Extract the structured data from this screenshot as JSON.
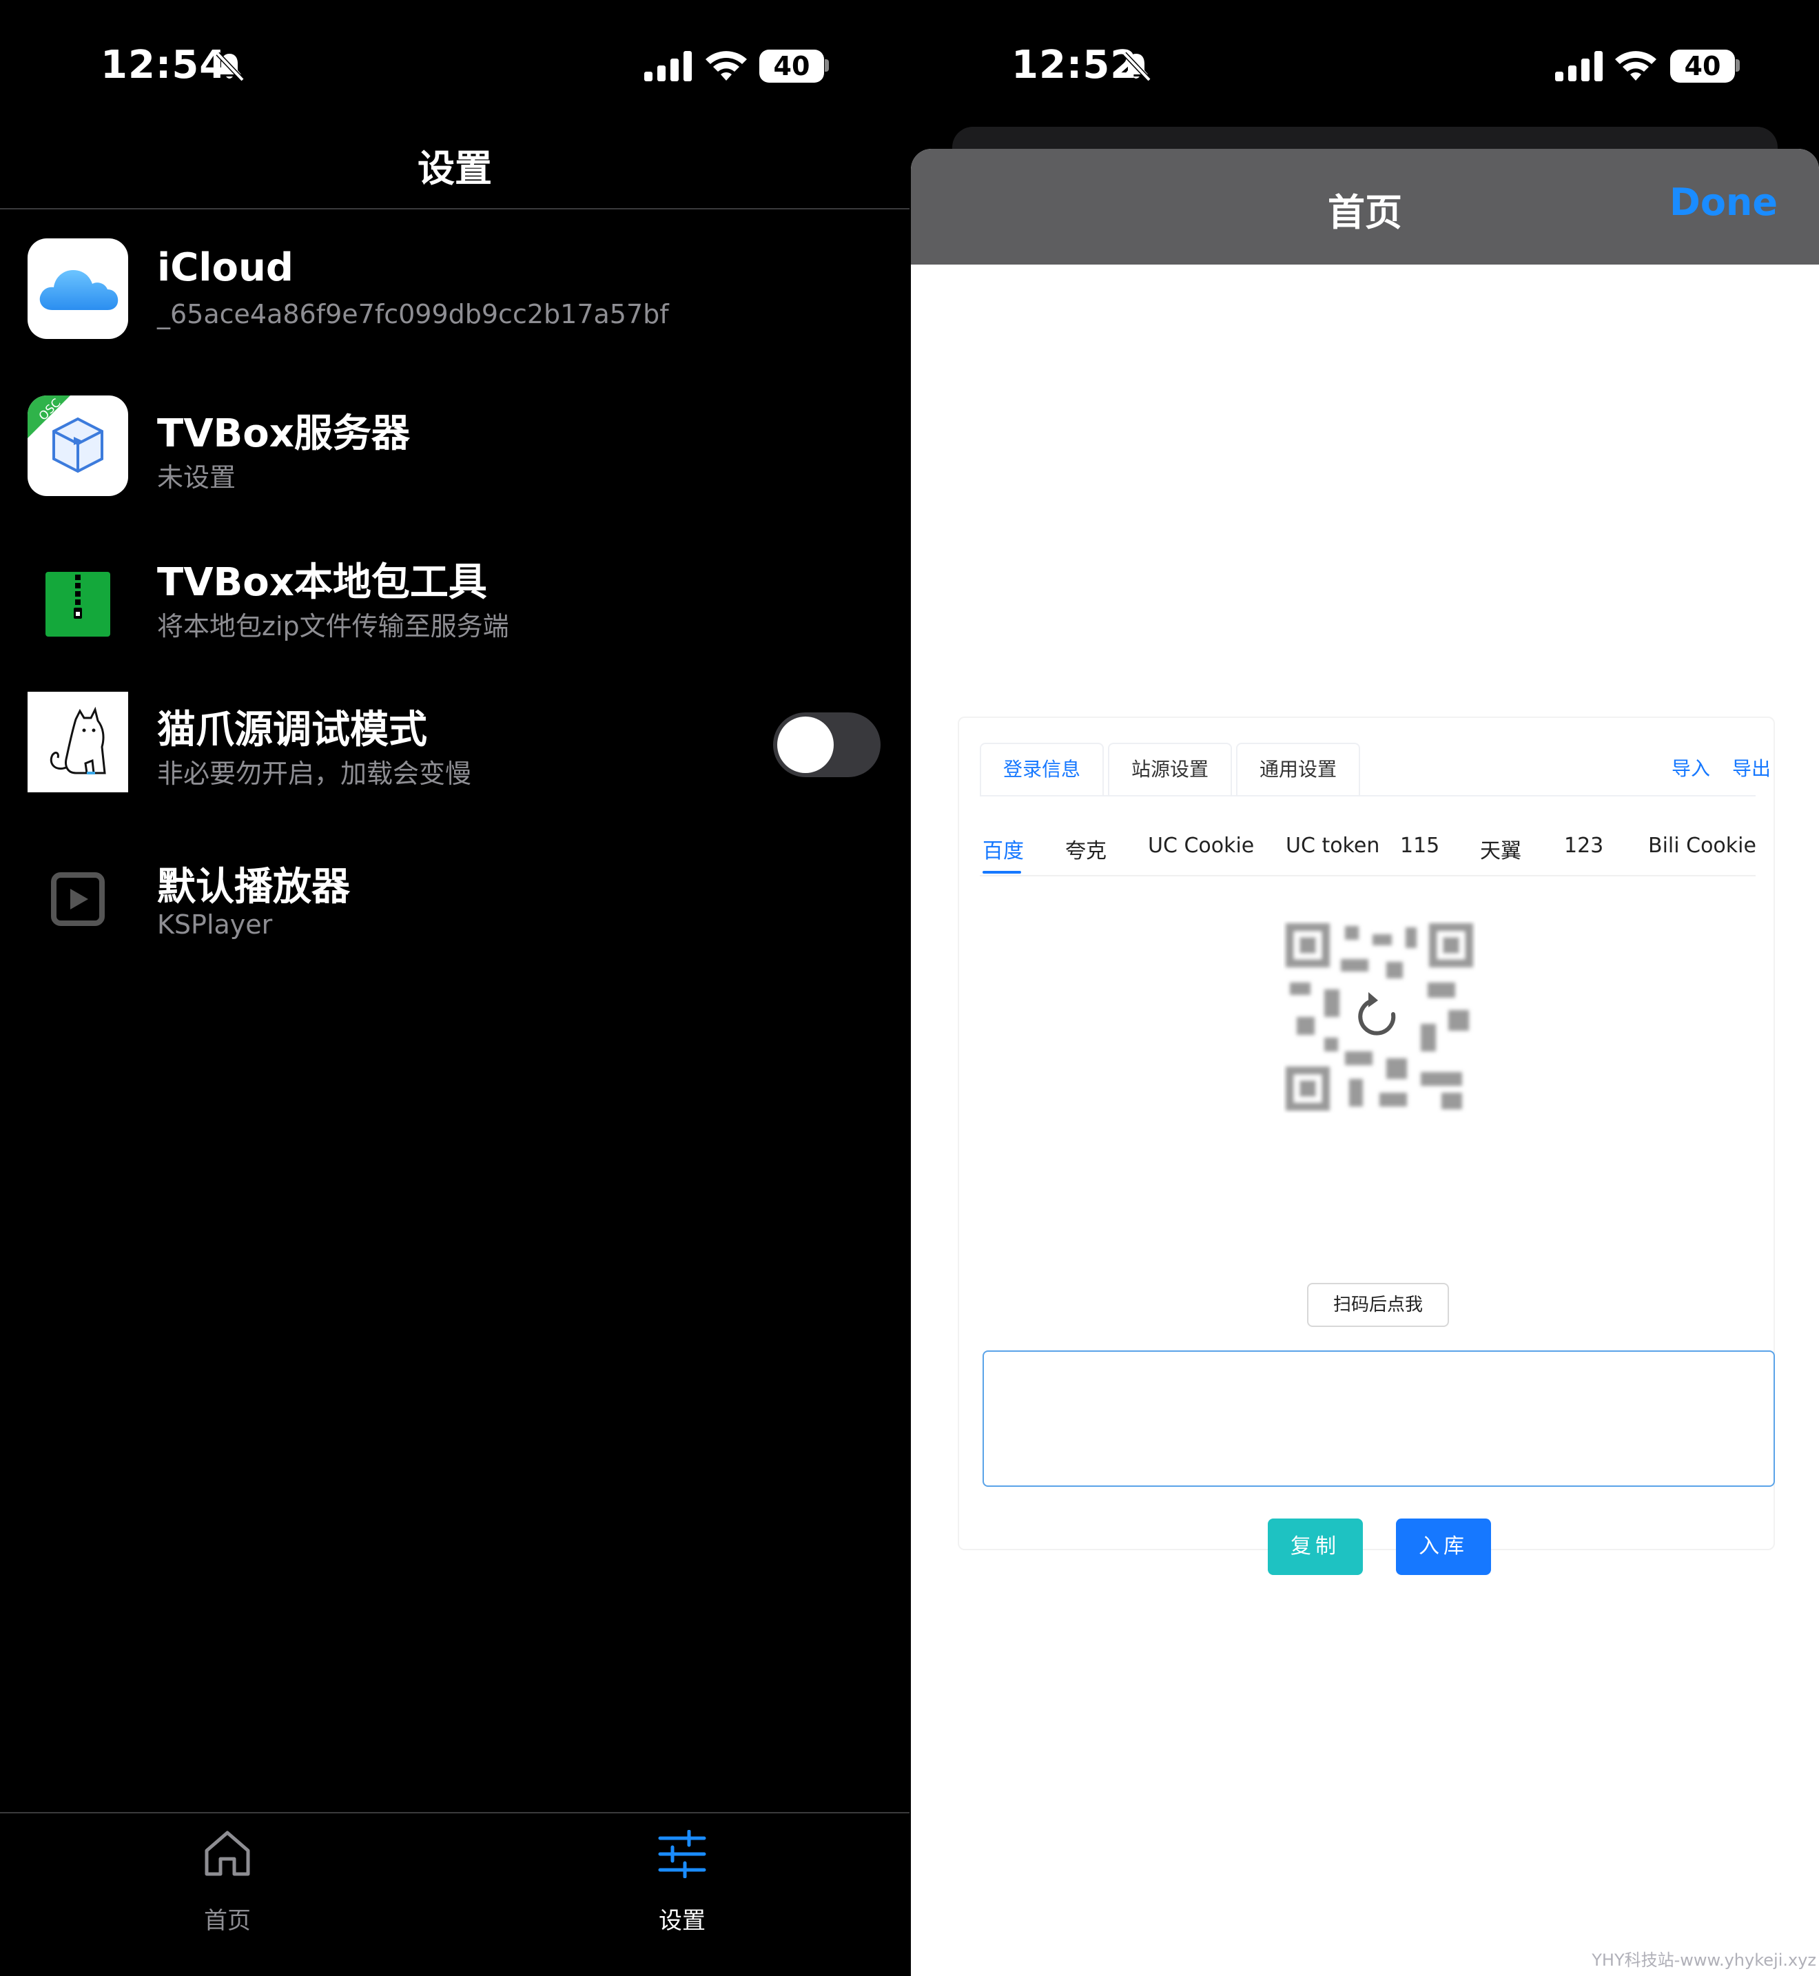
{
  "left": {
    "status": {
      "time": "12:54",
      "battery": "40"
    },
    "nav_title": "设置",
    "rows": [
      {
        "title": "iCloud",
        "subtitle": "_65ace4a86f9e7fc099db9cc2b17a57bf"
      },
      {
        "title": "TVBox服务器",
        "subtitle": "未设置",
        "badge": "OSC"
      },
      {
        "title": "TVBox本地包工具",
        "subtitle": "将本地包zip文件传输至服务端"
      },
      {
        "title": "猫爪源调试模式",
        "subtitle": "非必要勿开启，加载会变慢",
        "toggle": false
      },
      {
        "title": "默认播放器",
        "subtitle": "KSPlayer"
      }
    ],
    "tabbar": {
      "home_label": "首页",
      "settings_label": "设置"
    },
    "colors": {
      "accent": "#1a8cff",
      "secondary_text": "#8e8e93"
    }
  },
  "right": {
    "status": {
      "time": "12:52",
      "battery": "40"
    },
    "sheet_title": "首页",
    "done_label": "Done",
    "panel": {
      "tabs": [
        "登录信息",
        "站源设置",
        "通用设置"
      ],
      "links": {
        "import": "导入",
        "export": "导出"
      },
      "subtabs": [
        "百度",
        "夸克",
        "UC Cookie",
        "UC token",
        "115",
        "天翼",
        "123",
        "Bili Cookie"
      ],
      "scan_button": "扫码后点我",
      "copy_button": "复制",
      "store_button": "入库",
      "colors": {
        "primary": "#1678ff",
        "copy": "#1ec2c2"
      }
    },
    "watermark": "YHY科技站-www.yhykeji.xyz"
  }
}
